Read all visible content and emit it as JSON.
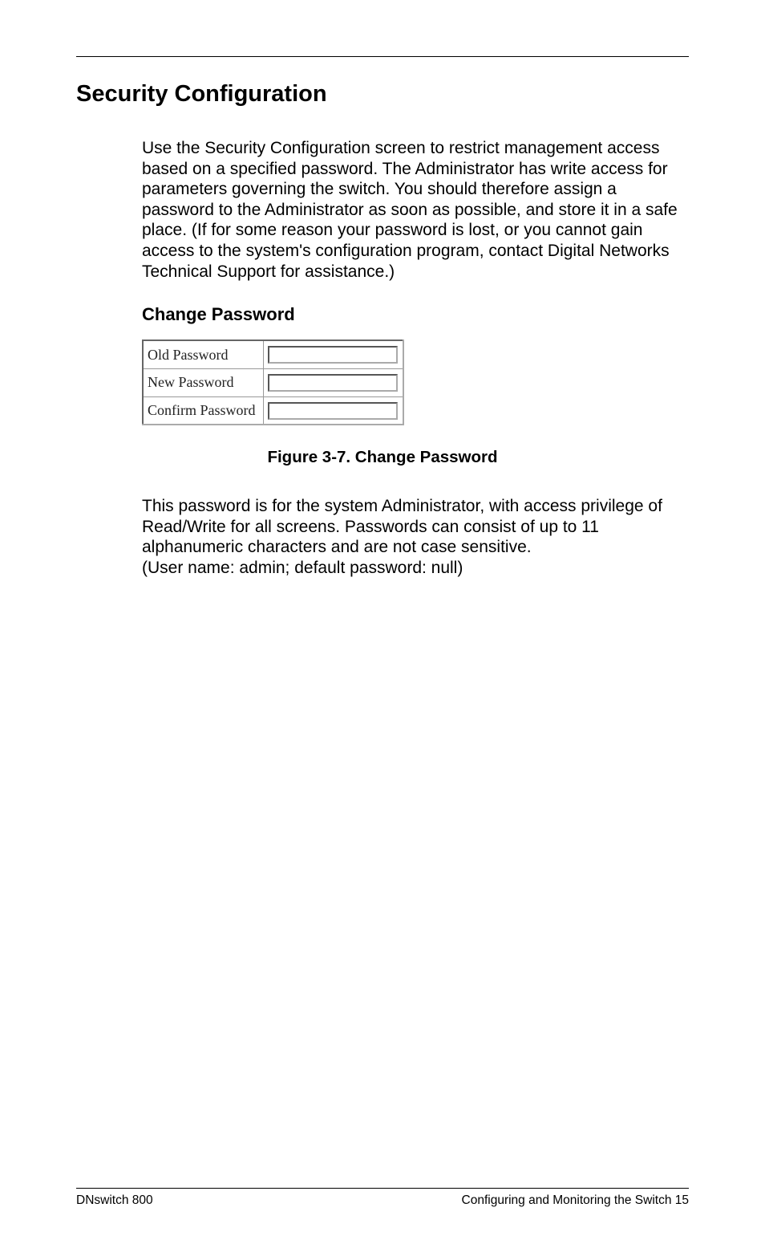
{
  "heading": "Security Configuration",
  "intro_paragraph": "Use the Security Configuration screen to restrict management access based on a specified password. The Administrator has write access for parameters governing the switch. You should therefore assign a password to the Administrator as soon as possible, and store it in a safe place. (If for some reason your password is lost, or you cannot gain access to the system's configuration program, contact Digital Networks Technical Support for assistance.)",
  "subheading": "Change Password",
  "form": {
    "old_password_label": "Old Password",
    "new_password_label": "New Password",
    "confirm_password_label": "Confirm Password",
    "old_password_value": "",
    "new_password_value": "",
    "confirm_password_value": ""
  },
  "figure_caption": "Figure 3-7.  Change Password",
  "body_paragraph": "This password is for the system Administrator, with access privilege of Read/Write for all screens. Passwords can consist of up to 11 alphanumeric characters and are not case sensitive.\n(User name: admin; default password: null)",
  "footer": {
    "left": "DNswitch 800",
    "right": "Configuring and Monitoring the Switch  15"
  }
}
